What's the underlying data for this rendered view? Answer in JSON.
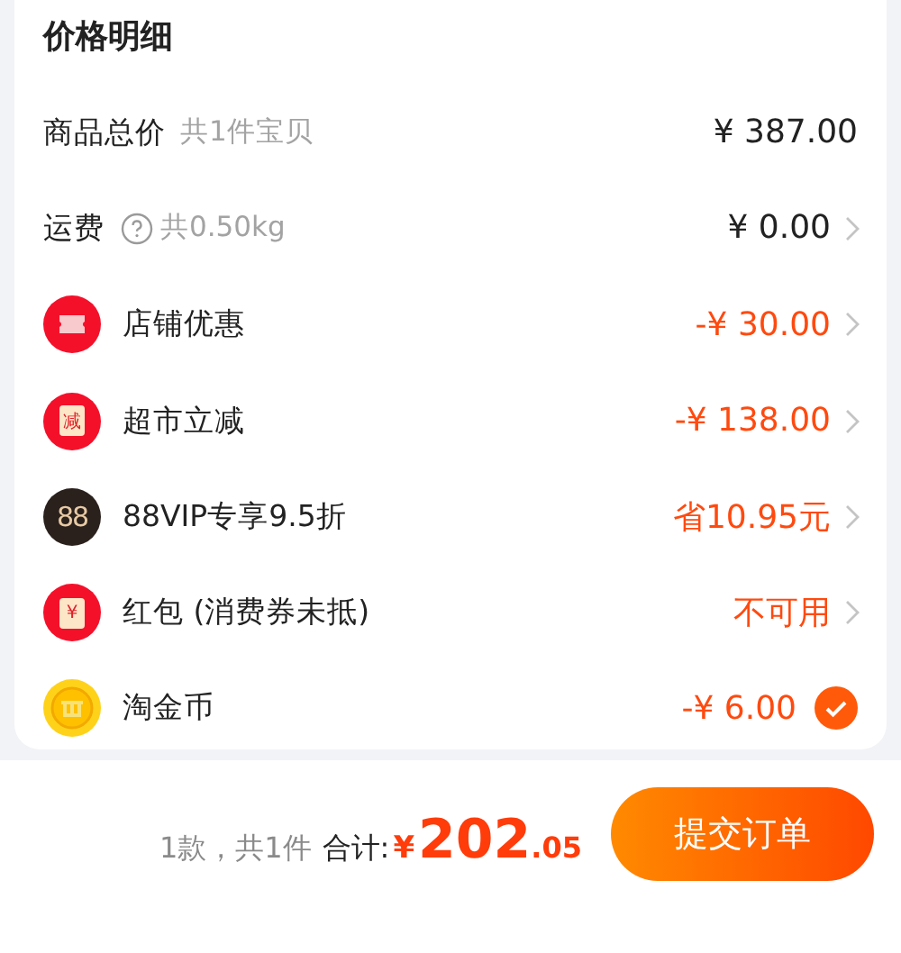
{
  "card": {
    "title": "价格明细",
    "rows": [
      {
        "kind": "plain",
        "label": "商品总价",
        "note": "共1件宝贝",
        "value": "¥ 387.00",
        "discount": false
      },
      {
        "kind": "link",
        "label": "运费",
        "help": true,
        "note": "共0.50kg",
        "value": "¥ 0.00",
        "discount": false
      },
      {
        "kind": "link",
        "icon": {
          "kind": "ticket"
        },
        "label": "店铺优惠",
        "value": "-¥ 30.00",
        "discount": true
      },
      {
        "kind": "link",
        "icon": {
          "kind": "box",
          "text": "减"
        },
        "label": "超市立减",
        "value": "-¥ 138.00",
        "discount": true
      },
      {
        "kind": "link",
        "icon": {
          "kind": "vip",
          "text": "88"
        },
        "label": "88VIP专享9.5折",
        "value": "省10.95元",
        "discount": true
      },
      {
        "kind": "link",
        "icon": {
          "kind": "box",
          "text": "¥"
        },
        "label": "红包 (消费券未抵)",
        "value": "不可用",
        "discount": true
      },
      {
        "kind": "toggle",
        "icon": {
          "kind": "coin"
        },
        "label": "淘金币",
        "value": "-¥ 6.00",
        "discount": true,
        "checked": true
      }
    ]
  },
  "footer": {
    "count": "1款，共1件",
    "total_label": "合计:",
    "currency": "¥",
    "total_int": "202",
    "total_dec": ".05",
    "submit": "提交订单"
  }
}
